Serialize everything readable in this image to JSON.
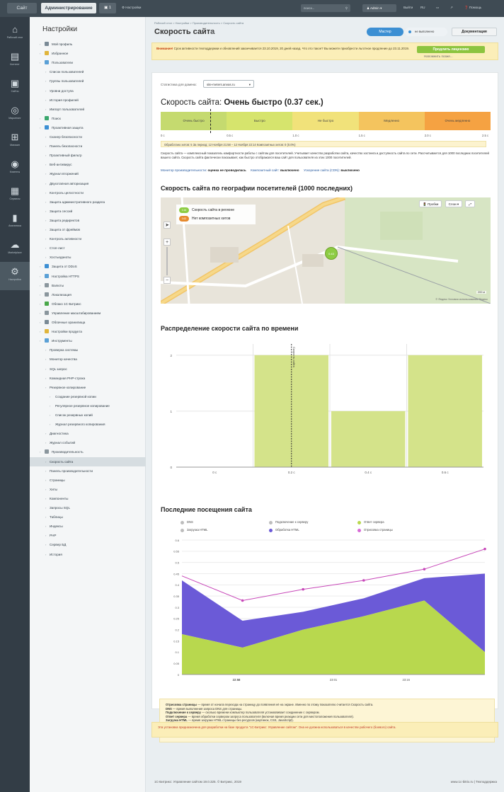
{
  "topbar": {
    "site_tab": "Сайт",
    "admin_tab": "Администрирование",
    "badge_count": "1",
    "settings_link": "Настройки",
    "search_placeholder": "поиск...",
    "user": "Admin",
    "exit": "Выйти",
    "lang": "RU",
    "help": "Помощь"
  },
  "iconbar": [
    {
      "icon": "home-icon",
      "glyph": "⌂",
      "label": "Рабочий стол"
    },
    {
      "icon": "content-icon",
      "glyph": "▤",
      "label": "Контент"
    },
    {
      "icon": "sites-icon",
      "glyph": "▣",
      "label": "Сайты"
    },
    {
      "icon": "marketing-icon",
      "glyph": "◎",
      "label": "Маркетинг"
    },
    {
      "icon": "store-icon",
      "glyph": "⊞",
      "label": "Магазин"
    },
    {
      "icon": "clients-icon",
      "glyph": "◉",
      "label": "Клиенты"
    },
    {
      "icon": "services-icon",
      "glyph": "▦",
      "label": "Сервисы"
    },
    {
      "icon": "analytics-icon",
      "glyph": "▮",
      "label": "Аналитика"
    },
    {
      "icon": "marketplace-icon",
      "glyph": "☁",
      "label": "Marketplace"
    },
    {
      "icon": "settings-icon",
      "glyph": "⚙",
      "label": "Настройки"
    }
  ],
  "menu": {
    "title": "Настройки",
    "items": [
      {
        "label": "Мой профиль",
        "level": 1
      },
      {
        "label": "Избранное",
        "level": 1
      },
      {
        "label": "Пользователи",
        "level": 1
      },
      {
        "label": "Список пользователей",
        "level": 2
      },
      {
        "label": "Группы пользователей",
        "level": 2
      },
      {
        "label": "Уровни доступа",
        "level": 2
      },
      {
        "label": "История профилей",
        "level": 2
      },
      {
        "label": "Импорт пользователей",
        "level": 2
      },
      {
        "label": "Поиск",
        "level": 1
      },
      {
        "label": "Проактивная защита",
        "level": 1
      },
      {
        "label": "Сканер безопасности",
        "level": 2
      },
      {
        "label": "Панель безопасности",
        "level": 2
      },
      {
        "label": "Проактивный фильтр",
        "level": 2
      },
      {
        "label": "Веб-антивирус",
        "level": 2
      },
      {
        "label": "Журнал вторжений",
        "level": 2
      },
      {
        "label": "Двухэтапная авторизация",
        "level": 2
      },
      {
        "label": "Контроль целостности",
        "level": 2
      },
      {
        "label": "Защита административного раздела",
        "level": 2
      },
      {
        "label": "Защита сессий",
        "level": 2
      },
      {
        "label": "Защита редиректов",
        "level": 2
      },
      {
        "label": "Защита от фреймов",
        "level": 2
      },
      {
        "label": "Контроль активности",
        "level": 2
      },
      {
        "label": "Стоп-лист",
        "level": 2
      },
      {
        "label": "Хостьеданоты",
        "level": 2
      },
      {
        "label": "Защита от DDoS",
        "level": 1
      },
      {
        "label": "Настройка HTTPS",
        "level": 1
      },
      {
        "label": "Валюты",
        "level": 1
      },
      {
        "label": "Локализация",
        "level": 1
      },
      {
        "label": "Облако 1С-Битрикс",
        "level": 1
      },
      {
        "label": "Управление масштабированием",
        "level": 1
      },
      {
        "label": "Облачные хранилища",
        "level": 1
      },
      {
        "label": "Настройки продукта",
        "level": 1
      },
      {
        "label": "Инструменты",
        "level": 1
      },
      {
        "label": "Проверка системы",
        "level": 2
      },
      {
        "label": "Монитор качества",
        "level": 2
      },
      {
        "label": "SQL запрос",
        "level": 2
      },
      {
        "label": "Командная PHP-строка",
        "level": 2
      },
      {
        "label": "Резервное копирование",
        "level": 2
      },
      {
        "label": "Создание резервной копии",
        "level": 3
      },
      {
        "label": "Регулярное резервное копирование",
        "level": 3
      },
      {
        "label": "Список резервных копий",
        "level": 3
      },
      {
        "label": "Журнал резервного копирования",
        "level": 3
      },
      {
        "label": "Диагностика",
        "level": 2
      },
      {
        "label": "Журнал событий",
        "level": 2
      },
      {
        "label": "Производительность",
        "level": 1
      },
      {
        "label": "Скорость сайта",
        "level": 2,
        "active": true
      },
      {
        "label": "Панель производительности",
        "level": 2
      },
      {
        "label": "Страницы",
        "level": 2
      },
      {
        "label": "Хиты",
        "level": 2
      },
      {
        "label": "Компоненты",
        "level": 2
      },
      {
        "label": "Запросы SQL",
        "level": 2
      },
      {
        "label": "Таблицы",
        "level": 2
      },
      {
        "label": "Индексы",
        "level": 2
      },
      {
        "label": "PHP",
        "level": 2
      },
      {
        "label": "Сервер БД",
        "level": 2
      },
      {
        "label": "История",
        "level": 2
      }
    ]
  },
  "content": {
    "breadcrumbs": "Рабочий стол  >  Настройки  >  Производительность  >  Скорость сайта",
    "title": "Скорость сайта",
    "master_btn": "Мастер",
    "not_done_btn": "не выполнено",
    "docs_btn": "Документация",
    "warning": {
      "bold": "Внимание!",
      "text": " Срок активности техподдержки и обновлений заканчивается 23.10.2019, 20 дней назад. Что это такое? Вы можете приобрести льготное продление до 23.11.2019.",
      "buy_btn": "Продлить лицензию",
      "remind_link": "Напомнить позже..."
    },
    "stat_label": "Статистика для домена:",
    "domain": "site-meters.anvas.ru",
    "speed_prefix": "Скорость сайта: ",
    "speed_value": "Очень быстро (0.37 сек.)",
    "scale": [
      {
        "label": "Очень быстро",
        "color": "#c5da6f"
      },
      {
        "label": "Быстро",
        "color": "#d6e46d"
      },
      {
        "label": "Не быстро",
        "color": "#f1e27a"
      },
      {
        "label": "Медленно",
        "color": "#f4c45e"
      },
      {
        "label": "Очень медленно",
        "color": "#f5a242"
      }
    ],
    "scale_ticks": [
      "0 с",
      "0.5 с",
      "1.0 с",
      "1.5 с",
      "2.0 с",
      "2.5 с"
    ],
    "processed": "Обработано хитов: 5     За период: 12 Ноября 21:58 – 12 Ноября 22:14     Композитных хитов: 0 (0.0%)",
    "description": "Скорость сайта — комплексный показатель комфортности работы с сайтом для посетителей. Учитывает качество разработки сайта, качество хостинга и доступность сайта по сети. Рассчитывается для 1000 последних посетителей вашего сайта. Скорость сайта фактически показывает, как быстро отображался ваш сайт для пользователя из этих 1000 посетителей.",
    "links": {
      "monitor": "Монитор производительности:",
      "monitor_val": "оценка не проводилась",
      "composite": "Композитный сайт:",
      "composite_val": "выключено",
      "cdn": "Ускорение сайта (CDN):",
      "cdn_val": "выключено"
    },
    "geo_title": "Скорость сайта по географии посетителей (1000 последних)",
    "map": {
      "legend": [
        {
          "value": "0.16",
          "label": "Скорость сайта в регионе",
          "color": "#8dcc43"
        },
        {
          "value": "0.62",
          "label": "Нет композитных хитов",
          "color": "#e68a2e"
        }
      ],
      "btn_traffic": "Пробки",
      "btn_layers": "Слои",
      "pin": "0.43",
      "scale": "200 м",
      "copyright": "© Яндекс  Условия использования  Яндекс"
    },
    "dist_title": "Распределение скорости сайта по времени",
    "visits_title": "Последние посещения сайта",
    "visits_legend": [
      {
        "label": "DNS",
        "color": "#bdbdbd"
      },
      {
        "label": "Подключение к серверу",
        "color": "#bdbdbd"
      },
      {
        "label": "Ответ сервера",
        "color": "#b8d84e"
      },
      {
        "label": "Загрузка HTML",
        "color": "#bdbdbd"
      },
      {
        "label": "Обработка HTML",
        "color": "#6b5ad7"
      },
      {
        "label": "Отрисовка страницы",
        "color": "#d76ad6"
      }
    ],
    "legend_text": [
      {
        "b": "Отрисовка страницы",
        "t": " — время от начала перехода на страницу до появления её на экране. Именно по этому показателю считается Скорость сайта."
      },
      {
        "b": "DNS",
        "t": " — время выполнения запроса DNS для страницы."
      },
      {
        "b": "Подключение к серверу",
        "t": " — сколько времени компьютер пользователя устанавливает соединение с сервером."
      },
      {
        "b": "Ответ сервера",
        "t": " — время обработки сервером запроса пользователя (включая время реакции сети для местоположения пользователя)."
      },
      {
        "b": "Загрузка HTML",
        "t": " — время загрузки HTML страницы без ресурсов (картинок, CSS, JavaScript)."
      },
      {
        "b": "Обработка HTML",
        "t": " — время, в течение которого браузер обрабатывает содержимое страницы (синтаксический анализ HTML, CSS, обработка элементов JavaScript и отображение страницы) после загрузки её с сервера и до начала отрисовки."
      }
    ],
    "promo": "Эта установка предназначена для разработки на базе продукта \"1С-Битрикс: Управление сайтом\". Она не должна использоваться в качестве рабочего (боевого) сайта.",
    "footer_left": "1С-Битрикс: Управление сайтом 19.0.325. © Битрикс, 2019",
    "footer_right": "www.1c-bitrix.ru  |  Техподдержка"
  },
  "chart_data": [
    {
      "type": "bar",
      "title": "Распределение скорости сайта по времени",
      "categories": [
        "0 с",
        "0.2 с",
        "0.4 с",
        "0.6 с"
      ],
      "bins": [
        0.1,
        0.3,
        0.5,
        0.7
      ],
      "values": [
        0,
        2,
        1,
        2
      ],
      "ylim": [
        0,
        2.2
      ],
      "yticks": [
        0,
        1,
        2
      ],
      "marker": {
        "x": 0.3,
        "label": "Скорость сайта"
      },
      "color": "#d4e38a"
    },
    {
      "type": "area",
      "title": "Последние посещения сайта",
      "x": [
        "22:58",
        "",
        "23:01",
        "",
        "23:16",
        ""
      ],
      "xticks": [
        "22:58",
        "23:01",
        "23:16"
      ],
      "ylim": [
        0,
        0.6
      ],
      "yticks": [
        0,
        0.05,
        0.1,
        0.15,
        0.2,
        0.25,
        0.3,
        0.35,
        0.4,
        0.45,
        0.5,
        0.55,
        0.6
      ],
      "series": [
        {
          "name": "Ответ сервера",
          "color": "#b8d84e",
          "values": [
            0.18,
            0.12,
            0.2,
            0.26,
            0.33,
            0.1
          ]
        },
        {
          "name": "Обработка HTML",
          "color": "#6b5ad7",
          "values": [
            0.42,
            0.24,
            0.28,
            0.34,
            0.43,
            0.45
          ]
        },
        {
          "name": "Отрисовка страницы",
          "color": "#c746b8",
          "values": [
            0.44,
            0.33,
            0.38,
            0.42,
            0.47,
            0.56
          ]
        }
      ]
    }
  ]
}
